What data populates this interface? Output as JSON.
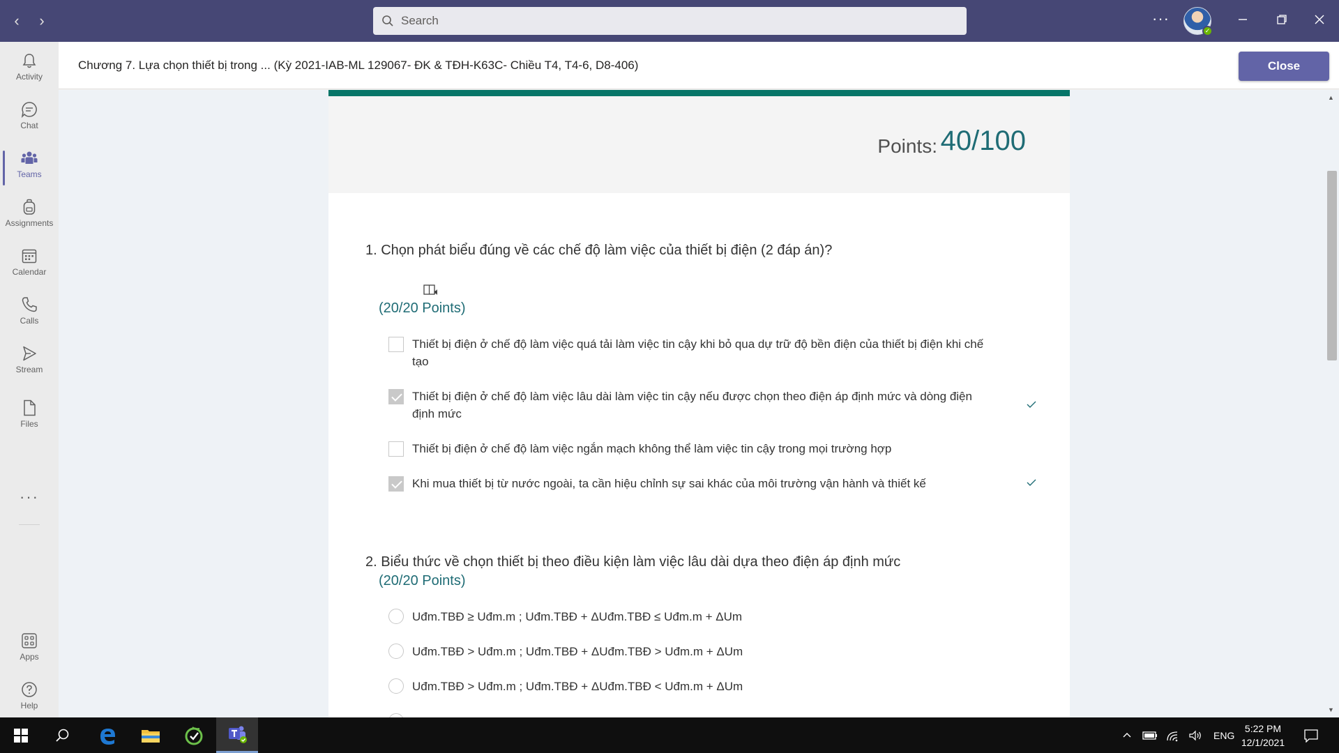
{
  "titlebar": {
    "search_placeholder": "Search",
    "more_label": "···"
  },
  "rail": {
    "items": [
      {
        "label": "Activity",
        "icon": "bell-icon"
      },
      {
        "label": "Chat",
        "icon": "chat-icon"
      },
      {
        "label": "Teams",
        "icon": "teams-icon",
        "active": true
      },
      {
        "label": "Assignments",
        "icon": "backpack-icon"
      },
      {
        "label": "Calendar",
        "icon": "calendar-icon"
      },
      {
        "label": "Calls",
        "icon": "phone-icon"
      },
      {
        "label": "Stream",
        "icon": "play-icon"
      },
      {
        "label": "Files",
        "icon": "file-icon"
      }
    ],
    "more_label": "···",
    "bottom": [
      {
        "label": "Apps",
        "icon": "apps-icon"
      },
      {
        "label": "Help",
        "icon": "help-icon"
      }
    ]
  },
  "header": {
    "title": "Chương 7. Lựa chọn thiết bị trong ... (Kỳ 2021-IAB-ML 129067- ĐK & TĐH-K63C- Chiều T4, T4-6, D8-406)",
    "close_label": "Close"
  },
  "form": {
    "points_label": "Points:",
    "points_value": "40/100",
    "questions": [
      {
        "title": "1.  Chọn phát biểu đúng về các chế độ làm việc của thiết bị điện  (2 đáp án)?",
        "points": "(20/20 Points)",
        "type": "checkbox",
        "options": [
          {
            "text": "Thiết bị điện ở chế độ làm việc quá tải làm việc tin cậy khi bỏ qua dự trữ độ bền điện của thiết bị điện khi chế tạo",
            "checked": false,
            "correct": false
          },
          {
            "text": "Thiết bị điện ở chế độ làm việc lâu dài làm việc tin cậy nếu được chọn theo điện áp định mức và dòng điện định mức",
            "checked": true,
            "correct": true
          },
          {
            "text": "Thiết bị điện ở chế độ làm việc ngắn mạch không thể làm việc tin cậy trong mọi trường hợp",
            "checked": false,
            "correct": false
          },
          {
            "text": "Khi mua thiết bị từ nước ngoài, ta cần hiệu chỉnh sự sai khác của môi trường vận hành và thiết kế",
            "checked": true,
            "correct": true
          }
        ]
      },
      {
        "title": "2. Biểu thức về chọn thiết bị theo điều kiện làm việc lâu dài dựa theo điện áp định mức",
        "points": "(20/20 Points)",
        "type": "radio",
        "options": [
          {
            "text": " Uđm.TBĐ ≥ Uđm.m ; Uđm.TBĐ + ΔUđm.TBĐ ≤ Uđm.m + ΔUm"
          },
          {
            "text": "Uđm.TBĐ > Uđm.m ; Uđm.TBĐ + ΔUđm.TBĐ > Uđm.m + ΔUm"
          },
          {
            "text": "Uđm.TBĐ > Uđm.m ; Uđm.TBĐ + ΔUđm.TBĐ < Uđm.m + ΔUm"
          }
        ]
      }
    ]
  },
  "taskbar": {
    "lang": "ENG",
    "time": "5:22 PM",
    "date": "12/1/2021"
  },
  "colors": {
    "titlebar": "#464775",
    "accent": "#6264a7",
    "form_accent": "#077568",
    "points": "#1f6c75"
  }
}
